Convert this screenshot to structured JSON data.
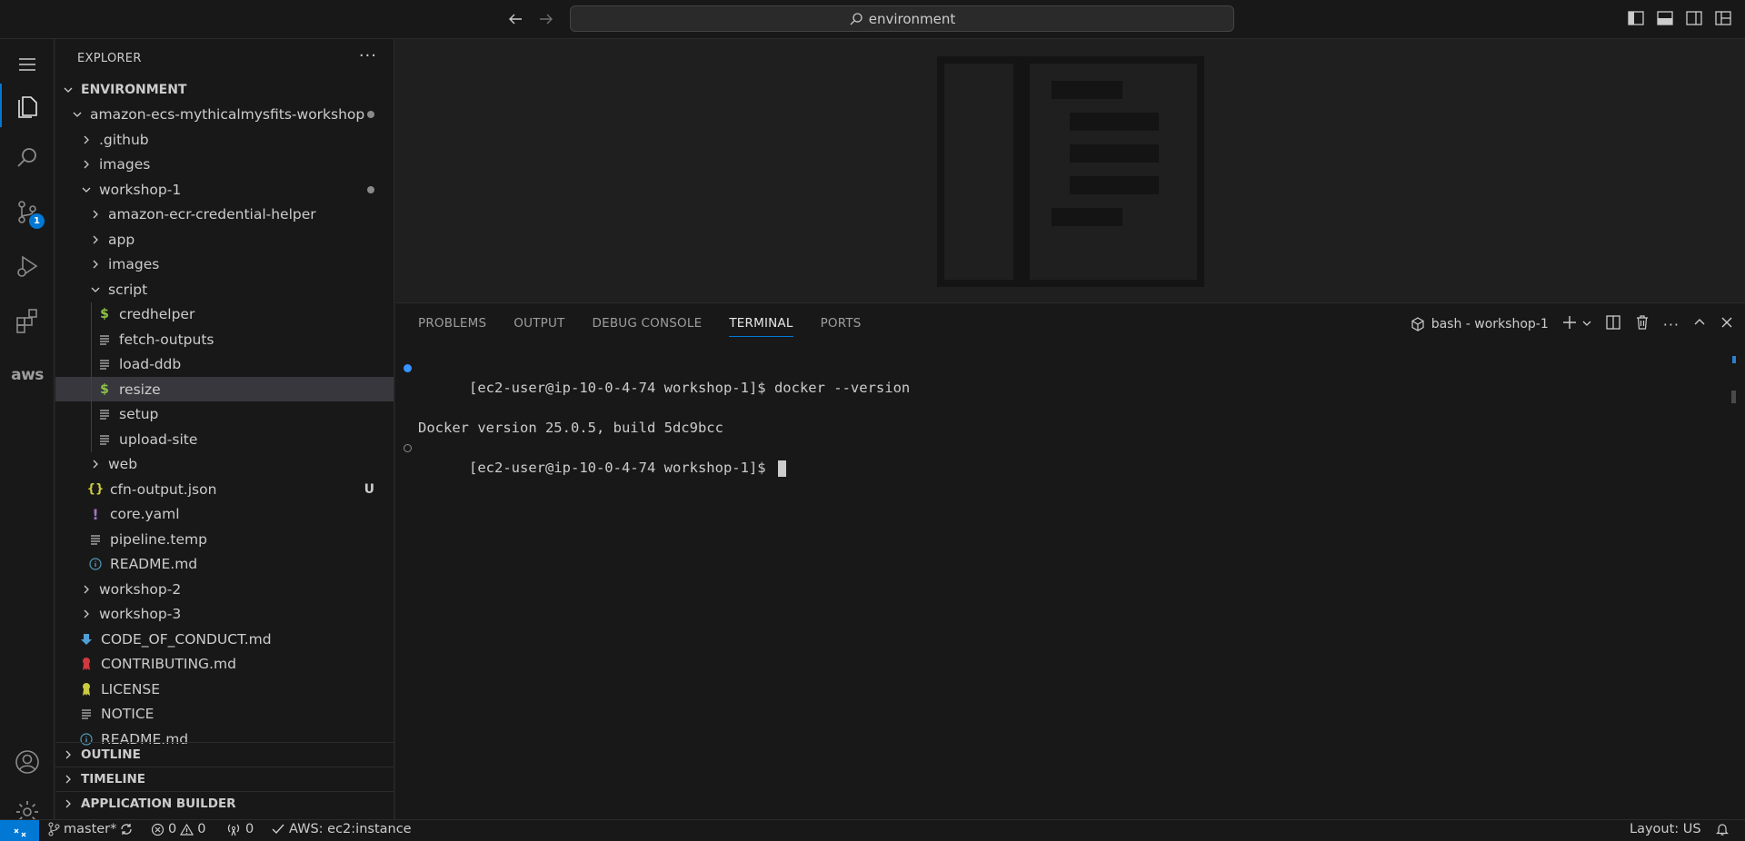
{
  "titlebar": {
    "search_text": "environment"
  },
  "activity": {
    "scm_badge": "1",
    "aws_label": "aws"
  },
  "explorer": {
    "header": "EXPLORER",
    "more": "···",
    "root": "ENVIRONMENT",
    "items": [
      {
        "label": "amazon-ecs-mythicalmysfits-workshop",
        "type": "folder-open",
        "status": "dot"
      },
      {
        "label": ".github",
        "type": "folder"
      },
      {
        "label": "images",
        "type": "folder"
      },
      {
        "label": "workshop-1",
        "type": "folder-open",
        "status": "dot"
      },
      {
        "label": "amazon-ecr-credential-helper",
        "type": "folder"
      },
      {
        "label": "app",
        "type": "folder"
      },
      {
        "label": "images",
        "type": "folder"
      },
      {
        "label": "script",
        "type": "folder-open"
      },
      {
        "label": "credhelper",
        "type": "shell"
      },
      {
        "label": "fetch-outputs",
        "type": "text"
      },
      {
        "label": "load-ddb",
        "type": "text"
      },
      {
        "label": "resize",
        "type": "shell"
      },
      {
        "label": "setup",
        "type": "text"
      },
      {
        "label": "upload-site",
        "type": "text"
      },
      {
        "label": "web",
        "type": "folder"
      },
      {
        "label": "cfn-output.json",
        "type": "json",
        "status": "U"
      },
      {
        "label": "core.yaml",
        "type": "yaml"
      },
      {
        "label": "pipeline.temp",
        "type": "text"
      },
      {
        "label": "README.md",
        "type": "info"
      },
      {
        "label": "workshop-2",
        "type": "folder"
      },
      {
        "label": "workshop-3",
        "type": "folder"
      },
      {
        "label": "CODE_OF_CONDUCT.md",
        "type": "download"
      },
      {
        "label": "CONTRIBUTING.md",
        "type": "ribbon-red"
      },
      {
        "label": "LICENSE",
        "type": "ribbon-yellow"
      },
      {
        "label": "NOTICE",
        "type": "text"
      },
      {
        "label": "README.md",
        "type": "info"
      }
    ],
    "sections": [
      "OUTLINE",
      "TIMELINE",
      "APPLICATION BUILDER"
    ]
  },
  "panel": {
    "tabs": [
      "PROBLEMS",
      "OUTPUT",
      "DEBUG CONSOLE",
      "TERMINAL",
      "PORTS"
    ],
    "active_tab": "TERMINAL",
    "terminal_name": "bash - workshop-1",
    "lines": [
      "[ec2-user@ip-10-0-4-74 workshop-1]$ docker --version",
      "Docker version 25.0.5, build 5dc9bcc",
      "[ec2-user@ip-10-0-4-74 workshop-1]$ "
    ]
  },
  "statusbar": {
    "branch": "master*",
    "errors": "0",
    "warnings": "0",
    "ports": "0",
    "aws": "AWS: ec2:instance",
    "layout": "Layout: US"
  },
  "colors": {
    "accent": "#0078d4",
    "shell_icon": "#8dc149",
    "json_icon": "#cbcb41",
    "yaml_icon": "#a074c4",
    "info_icon": "#519aba"
  }
}
